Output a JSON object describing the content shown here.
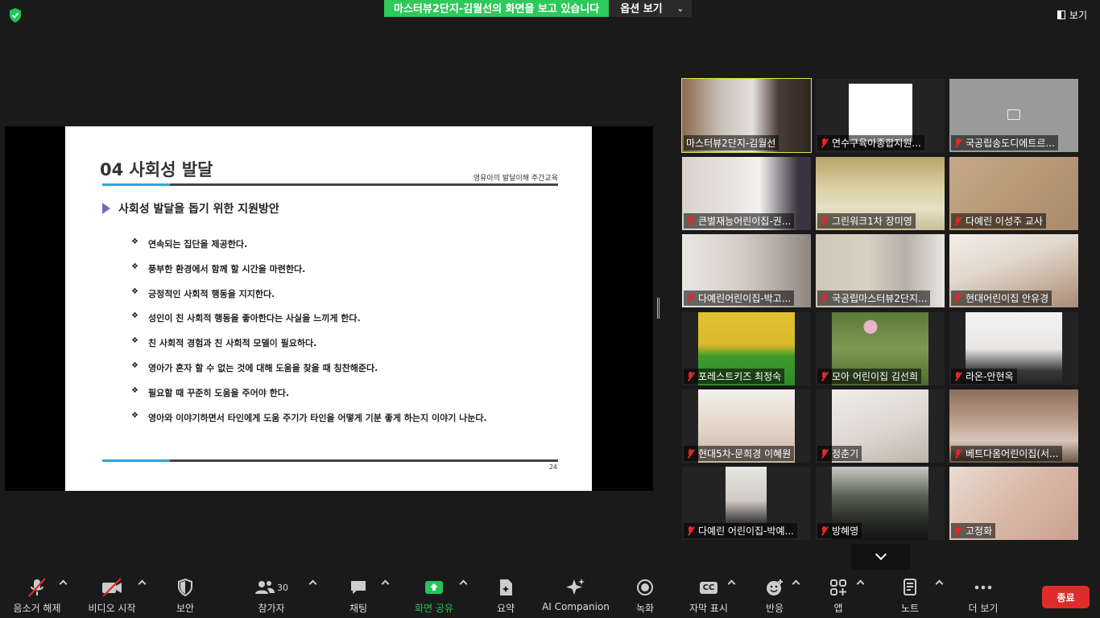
{
  "top": {
    "share_banner": "마스터뷰2단지-김월선의 화면을 보고 있습니다",
    "options_label": "옵션 보기",
    "view_label": "보기"
  },
  "slide": {
    "title": "04 사회성 발달",
    "tag": "영유아의 발달이해 주간교육",
    "subtitle": "사회성 발달을 돕기 위한 지원방안",
    "bullets": [
      "연속되는 집단을 제공한다.",
      "풍부한 환경에서 함께 할 시간을 마련한다.",
      "긍정적인 사회적 행동을 지지한다.",
      "성인이 친 사회적 행동을 좋아한다는 사실을 느끼게 한다.",
      "친 사회적 경험과 친 사회적 모델이 필요하다.",
      "영아가 혼자 할 수 없는 것에 대해 도움을 찾을 때 칭찬해준다.",
      "필요할 때 꾸준히 도움을 주어야 한다.",
      "영아와 이야기하면서 타인에게 도움 주기가 타인을 어떻게 기분 좋게  하는지 이야기 나눈다."
    ],
    "page": "24"
  },
  "participants": [
    {
      "name": "마스터뷰2단지-김월선",
      "muted": false,
      "active": true
    },
    {
      "name": "연수구육아종합지원...",
      "muted": true
    },
    {
      "name": "국공립송도디에트르...",
      "muted": true,
      "camera_off": true
    },
    {
      "name": "큰별재능어린이집-권...",
      "muted": true
    },
    {
      "name": "그린워크1차 장미영",
      "muted": true
    },
    {
      "name": "다예린 이성주 교사",
      "muted": true
    },
    {
      "name": "다예린어린이집-박고...",
      "muted": true
    },
    {
      "name": "국공립마스터뷰2단지...",
      "muted": true
    },
    {
      "name": "현대어린이집 안유경",
      "muted": true
    },
    {
      "name": "포레스트키즈 최정숙",
      "muted": true
    },
    {
      "name": "모아 어린이집 김선희",
      "muted": true
    },
    {
      "name": "라온-안현옥",
      "muted": true
    },
    {
      "name": "현대5차-문희경 이혜원",
      "muted": true
    },
    {
      "name": "정춘기",
      "muted": true
    },
    {
      "name": "베트다옴어린이집(서...",
      "muted": true
    },
    {
      "name": "다예린 어린이집-박예...",
      "muted": true
    },
    {
      "name": "방혜영",
      "muted": true
    },
    {
      "name": "고정화",
      "muted": true
    }
  ],
  "toolbar": {
    "unmute": "음소거 해제",
    "start_video": "비디오 시작",
    "security": "보안",
    "participants": "참가자",
    "participants_count": "30",
    "chat": "채팅",
    "share_screen": "화면 공유",
    "summary": "요약",
    "ai_companion": "AI Companion",
    "record": "녹화",
    "captions": "자막 표시",
    "cc": "CC",
    "reactions": "반응",
    "apps": "앱",
    "notes": "노트",
    "more": "더 보기",
    "end": "종료"
  },
  "colors": {
    "share_green": "#2ec95c",
    "active_speaker": "#dfe54e",
    "end_red": "#e02b2b",
    "muted_red": "#e02828",
    "slide_accent": "#2aa7d9"
  }
}
